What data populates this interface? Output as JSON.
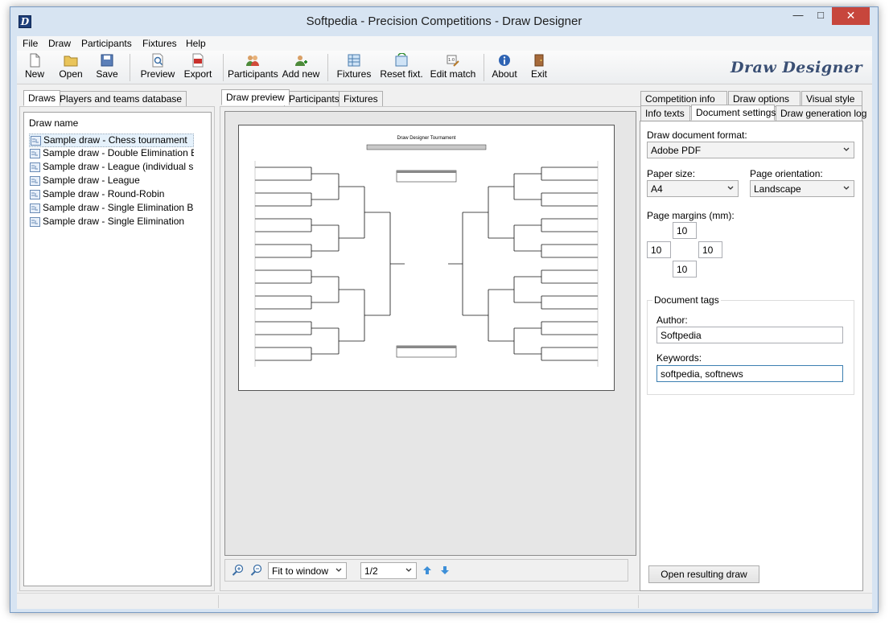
{
  "window": {
    "title": "Softpedia - Precision Competitions - Draw Designer",
    "app_icon_letter": "D"
  },
  "menu": [
    "File",
    "Draw",
    "Participants",
    "Fixtures",
    "Help"
  ],
  "toolbar": {
    "buttons": [
      "New",
      "Open",
      "Save",
      "Preview",
      "Export",
      "Participants",
      "Add new",
      "Fixtures",
      "Reset fixt.",
      "Edit match",
      "About",
      "Exit"
    ],
    "brand": "Draw Designer"
  },
  "left_panel": {
    "tabs": [
      "Draws",
      "Players and teams database"
    ],
    "list_header": "Draw name",
    "items": [
      "Sample draw - Chess tournament",
      "Sample draw - Double Elimination Blank",
      "Sample draw - League (individual sp...",
      "Sample draw - League",
      "Sample draw - Round-Robin",
      "Sample draw - Single Elimination Blank",
      "Sample draw - Single Elimination"
    ]
  },
  "center_panel": {
    "tabs": [
      "Draw preview",
      "Participants",
      "Fixtures"
    ],
    "preview_title": "Draw Designer Tournament",
    "zoom": "Fit to window",
    "page": "1/2"
  },
  "right_panel": {
    "tabs_row1": [
      "Competition info",
      "Draw options",
      "Visual style"
    ],
    "tabs_row2": [
      "Info texts",
      "Document settings",
      "Draw generation log"
    ],
    "format_label": "Draw document format:",
    "format_value": "Adobe PDF",
    "paper_label": "Paper size:",
    "paper_value": "A4",
    "orientation_label": "Page orientation:",
    "orientation_value": "Landscape",
    "margins_label": "Page margins (mm):",
    "margin_top": "10",
    "margin_left": "10",
    "margin_right": "10",
    "margin_bottom": "10",
    "tags_title": "Document tags",
    "author_label": "Author:",
    "author_value": "Softpedia",
    "keywords_label": "Keywords:",
    "keywords_value": "softpedia, softnews",
    "open_button": "Open resulting draw"
  }
}
